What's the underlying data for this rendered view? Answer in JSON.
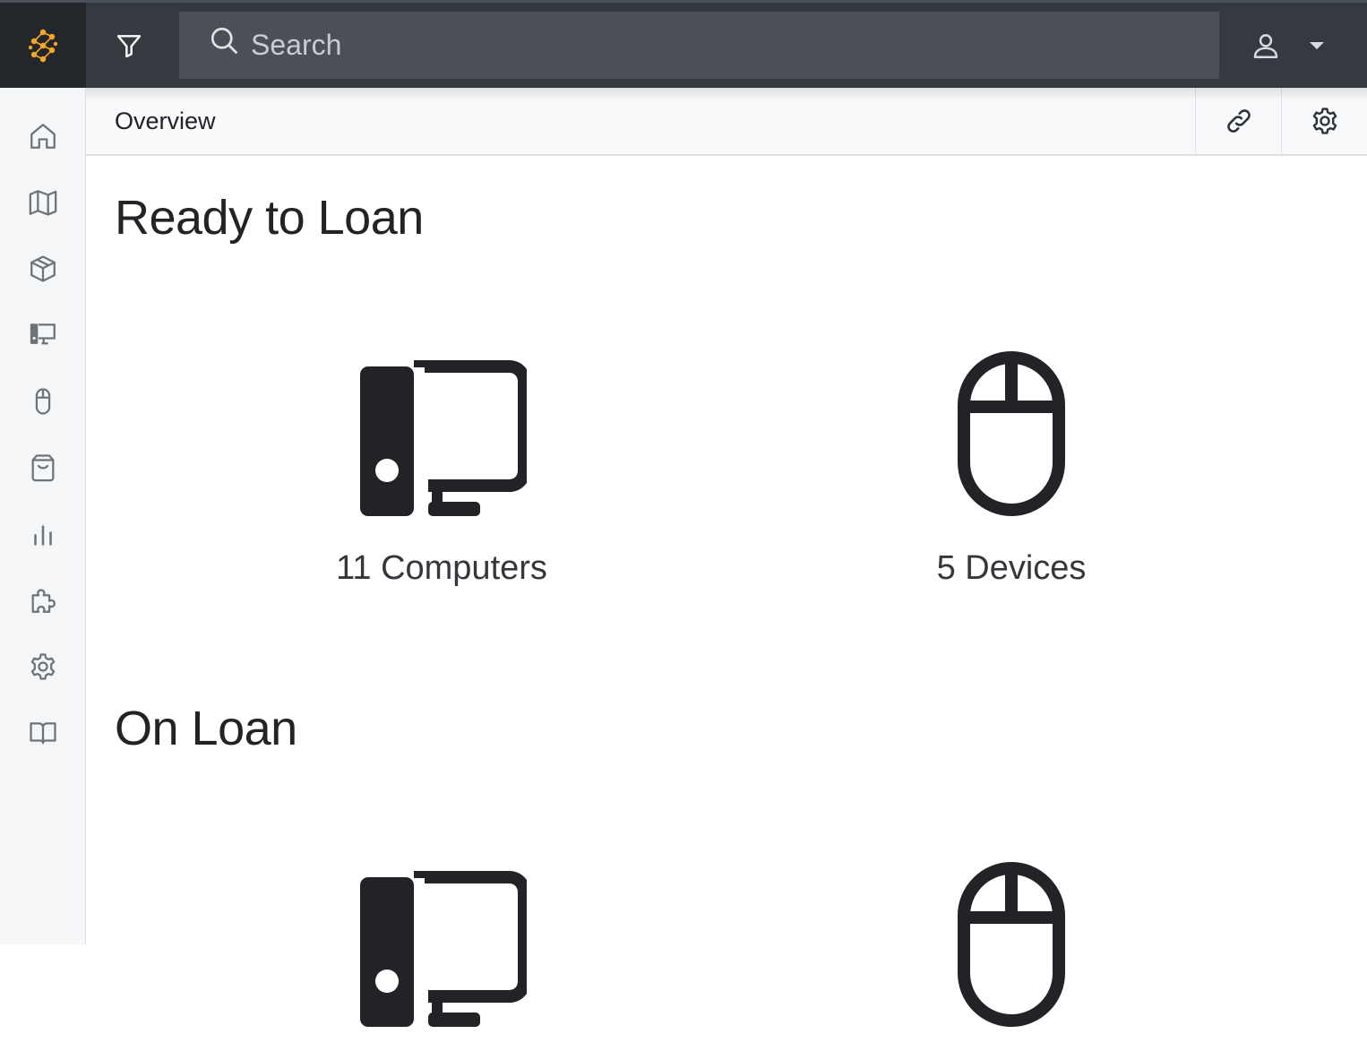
{
  "header": {
    "search_placeholder": "Search",
    "accent_color": "#f5a623"
  },
  "sidebar": {
    "items": [
      {
        "icon": "home-icon"
      },
      {
        "icon": "map-icon"
      },
      {
        "icon": "box-icon"
      },
      {
        "icon": "computer-icon"
      },
      {
        "icon": "mouse-icon"
      },
      {
        "icon": "bag-icon"
      },
      {
        "icon": "chart-icon"
      },
      {
        "icon": "puzzle-icon"
      },
      {
        "icon": "gear-icon"
      },
      {
        "icon": "book-icon"
      }
    ]
  },
  "subbar": {
    "title": "Overview"
  },
  "sections": [
    {
      "title": "Ready to Loan",
      "cards": [
        {
          "label": "11 Computers",
          "icon": "computer-icon"
        },
        {
          "label": "5 Devices",
          "icon": "mouse-icon"
        }
      ]
    },
    {
      "title": "On Loan",
      "cards": [
        {
          "label": "",
          "icon": "computer-icon"
        },
        {
          "label": "",
          "icon": "mouse-icon"
        }
      ]
    }
  ]
}
